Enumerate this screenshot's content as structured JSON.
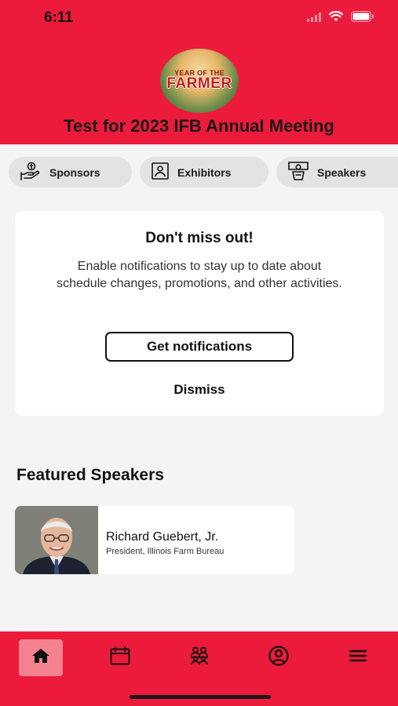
{
  "status_bar": {
    "time": "6:11"
  },
  "header": {
    "logo": {
      "line1": "YEAR OF THE",
      "line2": "FARMER"
    },
    "event_title": "Test for 2023 IFB Annual Meeting"
  },
  "quick_links": [
    {
      "label": "Sponsors",
      "icon": "sponsor-hand-icon"
    },
    {
      "label": "Exhibitors",
      "icon": "exhibitor-badge-icon"
    },
    {
      "label": "Speakers",
      "icon": "speaker-podium-icon"
    }
  ],
  "notification_card": {
    "title": "Don't miss out!",
    "body": "Enable notifications to stay up to date about schedule changes, promotions, and other activities.",
    "primary_button": "Get notifications",
    "dismiss_button": "Dismiss"
  },
  "featured_speakers": {
    "title": "Featured Speakers",
    "items": [
      {
        "name": "Richard Guebert, Jr.",
        "role": "President, Illinois Farm Bureau"
      }
    ]
  },
  "tab_bar": {
    "items": [
      {
        "icon": "home-icon",
        "active": true
      },
      {
        "icon": "calendar-icon",
        "active": false
      },
      {
        "icon": "people-icon",
        "active": false
      },
      {
        "icon": "profile-icon",
        "active": false
      },
      {
        "icon": "menu-icon",
        "active": false
      }
    ]
  },
  "colors": {
    "brand": "#ec1a3b",
    "pill_bg": "#e3e3e3",
    "active_tab": "#f4838f"
  }
}
